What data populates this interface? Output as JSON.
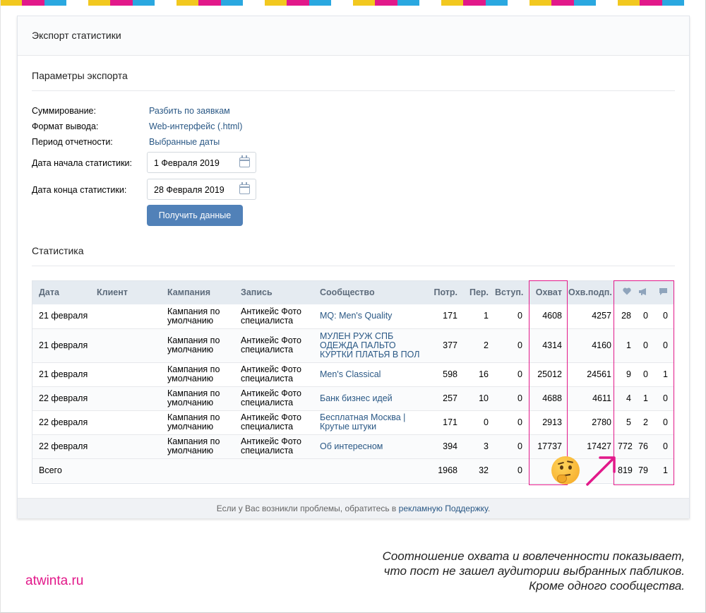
{
  "window": {
    "title": "Экспорт статистики"
  },
  "params_section": {
    "title": "Параметры экспорта",
    "rows": [
      {
        "label": "Суммирование:",
        "value": "Разбить по заявкам"
      },
      {
        "label": "Формат вывода:",
        "value": "Web-интерфейс (.html)"
      },
      {
        "label": "Период отчетности:",
        "value": "Выбранные даты"
      }
    ],
    "start_date": {
      "label": "Дата начала статистики:",
      "value": "1 Февраля 2019"
    },
    "end_date": {
      "label": "Дата конца статистики:",
      "value": "28 Февраля 2019"
    },
    "submit_label": "Получить данные"
  },
  "stats_section": {
    "title": "Статистика",
    "headers": {
      "date": "Дата",
      "client": "Клиент",
      "campaign": "Кампания",
      "post": "Запись",
      "community": "Сообщество",
      "spent": "Потр.",
      "clicks": "Пер.",
      "joins": "Вступ.",
      "reach": "Охват",
      "reach_subs": "Охв.подп."
    },
    "header_icons": [
      "heart-icon",
      "megaphone-icon",
      "comment-icon"
    ],
    "rows": [
      {
        "date": "21 февраля",
        "client": "",
        "campaign": "Кампания по умолчанию",
        "post": "Антикейс Фото специалиста",
        "community": "MQ: Men's Quality",
        "spent": "171",
        "clicks": "1",
        "joins": "0",
        "reach": "4608",
        "reach_subs": "4257",
        "likes": "28",
        "reposts": "0",
        "comments": "0"
      },
      {
        "date": "21 февраля",
        "client": "",
        "campaign": "Кампания по умолчанию",
        "post": "Антикейс Фото специалиста",
        "community": "МУЛЕН РУЖ СПБ ОДЕЖДА ПАЛЬТО КУРТКИ ПЛАТЬЯ В ПОЛ",
        "spent": "377",
        "clicks": "2",
        "joins": "0",
        "reach": "4314",
        "reach_subs": "4160",
        "likes": "1",
        "reposts": "0",
        "comments": "0"
      },
      {
        "date": "21 февраля",
        "client": "",
        "campaign": "Кампания по умолчанию",
        "post": "Антикейс Фото специалиста",
        "community": "Men's Classical",
        "spent": "598",
        "clicks": "16",
        "joins": "0",
        "reach": "25012",
        "reach_subs": "24561",
        "likes": "9",
        "reposts": "0",
        "comments": "1"
      },
      {
        "date": "22 февраля",
        "client": "",
        "campaign": "Кампания по умолчанию",
        "post": "Антикейс Фото специалиста",
        "community": "Банк бизнес идей",
        "spent": "257",
        "clicks": "10",
        "joins": "0",
        "reach": "4688",
        "reach_subs": "4611",
        "likes": "4",
        "reposts": "1",
        "comments": "0"
      },
      {
        "date": "22 февраля",
        "client": "",
        "campaign": "Кампания по умолчанию",
        "post": "Антикейс Фото специалиста",
        "community": "Бесплатная Москва | Крутые штуки",
        "spent": "171",
        "clicks": "0",
        "joins": "0",
        "reach": "2913",
        "reach_subs": "2780",
        "likes": "5",
        "reposts": "2",
        "comments": "0"
      },
      {
        "date": "22 февраля",
        "client": "",
        "campaign": "Кампания по умолчанию",
        "post": "Антикейс Фото специалиста",
        "community": "Об интересном",
        "spent": "394",
        "clicks": "3",
        "joins": "0",
        "reach": "17737",
        "reach_subs": "17427",
        "likes": "772",
        "reposts": "76",
        "comments": "0"
      }
    ],
    "total": {
      "label": "Всего",
      "spent": "1968",
      "clicks": "32",
      "joins": "0",
      "likes": "819",
      "reposts": "79",
      "comments": "1"
    }
  },
  "footer": {
    "text_before": "Если у Вас возникли проблемы, обратитесь в ",
    "link": "рекламную Поддержку",
    "text_after": "."
  },
  "brand": "atwinta.ru",
  "caption": {
    "line1": "Соотношение охвата и вовлеченности показывает,",
    "line2": "что пост не зашел аудитории выбранных пабликов.",
    "line3": "Кроме одного сообщества."
  },
  "colors": {
    "stripe": [
      "#f2c81f",
      "#e2198a",
      "#2aa8e0",
      "#ffffff"
    ],
    "highlight": "#e2198a",
    "link": "#2a5885",
    "button": "#5181b8",
    "header_row": "#e5ebf1"
  }
}
